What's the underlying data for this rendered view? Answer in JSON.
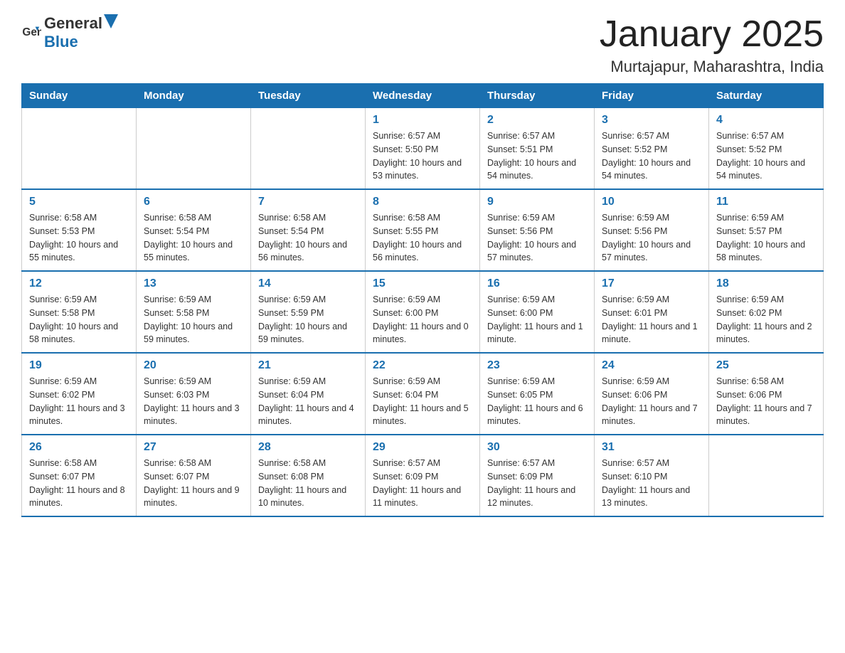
{
  "header": {
    "logo_general": "General",
    "logo_blue": "Blue",
    "title": "January 2025",
    "subtitle": "Murtajapur, Maharashtra, India"
  },
  "days_of_week": [
    "Sunday",
    "Monday",
    "Tuesday",
    "Wednesday",
    "Thursday",
    "Friday",
    "Saturday"
  ],
  "weeks": [
    [
      {
        "day": "",
        "info": ""
      },
      {
        "day": "",
        "info": ""
      },
      {
        "day": "",
        "info": ""
      },
      {
        "day": "1",
        "info": "Sunrise: 6:57 AM\nSunset: 5:50 PM\nDaylight: 10 hours and 53 minutes."
      },
      {
        "day": "2",
        "info": "Sunrise: 6:57 AM\nSunset: 5:51 PM\nDaylight: 10 hours and 54 minutes."
      },
      {
        "day": "3",
        "info": "Sunrise: 6:57 AM\nSunset: 5:52 PM\nDaylight: 10 hours and 54 minutes."
      },
      {
        "day": "4",
        "info": "Sunrise: 6:57 AM\nSunset: 5:52 PM\nDaylight: 10 hours and 54 minutes."
      }
    ],
    [
      {
        "day": "5",
        "info": "Sunrise: 6:58 AM\nSunset: 5:53 PM\nDaylight: 10 hours and 55 minutes."
      },
      {
        "day": "6",
        "info": "Sunrise: 6:58 AM\nSunset: 5:54 PM\nDaylight: 10 hours and 55 minutes."
      },
      {
        "day": "7",
        "info": "Sunrise: 6:58 AM\nSunset: 5:54 PM\nDaylight: 10 hours and 56 minutes."
      },
      {
        "day": "8",
        "info": "Sunrise: 6:58 AM\nSunset: 5:55 PM\nDaylight: 10 hours and 56 minutes."
      },
      {
        "day": "9",
        "info": "Sunrise: 6:59 AM\nSunset: 5:56 PM\nDaylight: 10 hours and 57 minutes."
      },
      {
        "day": "10",
        "info": "Sunrise: 6:59 AM\nSunset: 5:56 PM\nDaylight: 10 hours and 57 minutes."
      },
      {
        "day": "11",
        "info": "Sunrise: 6:59 AM\nSunset: 5:57 PM\nDaylight: 10 hours and 58 minutes."
      }
    ],
    [
      {
        "day": "12",
        "info": "Sunrise: 6:59 AM\nSunset: 5:58 PM\nDaylight: 10 hours and 58 minutes."
      },
      {
        "day": "13",
        "info": "Sunrise: 6:59 AM\nSunset: 5:58 PM\nDaylight: 10 hours and 59 minutes."
      },
      {
        "day": "14",
        "info": "Sunrise: 6:59 AM\nSunset: 5:59 PM\nDaylight: 10 hours and 59 minutes."
      },
      {
        "day": "15",
        "info": "Sunrise: 6:59 AM\nSunset: 6:00 PM\nDaylight: 11 hours and 0 minutes."
      },
      {
        "day": "16",
        "info": "Sunrise: 6:59 AM\nSunset: 6:00 PM\nDaylight: 11 hours and 1 minute."
      },
      {
        "day": "17",
        "info": "Sunrise: 6:59 AM\nSunset: 6:01 PM\nDaylight: 11 hours and 1 minute."
      },
      {
        "day": "18",
        "info": "Sunrise: 6:59 AM\nSunset: 6:02 PM\nDaylight: 11 hours and 2 minutes."
      }
    ],
    [
      {
        "day": "19",
        "info": "Sunrise: 6:59 AM\nSunset: 6:02 PM\nDaylight: 11 hours and 3 minutes."
      },
      {
        "day": "20",
        "info": "Sunrise: 6:59 AM\nSunset: 6:03 PM\nDaylight: 11 hours and 3 minutes."
      },
      {
        "day": "21",
        "info": "Sunrise: 6:59 AM\nSunset: 6:04 PM\nDaylight: 11 hours and 4 minutes."
      },
      {
        "day": "22",
        "info": "Sunrise: 6:59 AM\nSunset: 6:04 PM\nDaylight: 11 hours and 5 minutes."
      },
      {
        "day": "23",
        "info": "Sunrise: 6:59 AM\nSunset: 6:05 PM\nDaylight: 11 hours and 6 minutes."
      },
      {
        "day": "24",
        "info": "Sunrise: 6:59 AM\nSunset: 6:06 PM\nDaylight: 11 hours and 7 minutes."
      },
      {
        "day": "25",
        "info": "Sunrise: 6:58 AM\nSunset: 6:06 PM\nDaylight: 11 hours and 7 minutes."
      }
    ],
    [
      {
        "day": "26",
        "info": "Sunrise: 6:58 AM\nSunset: 6:07 PM\nDaylight: 11 hours and 8 minutes."
      },
      {
        "day": "27",
        "info": "Sunrise: 6:58 AM\nSunset: 6:07 PM\nDaylight: 11 hours and 9 minutes."
      },
      {
        "day": "28",
        "info": "Sunrise: 6:58 AM\nSunset: 6:08 PM\nDaylight: 11 hours and 10 minutes."
      },
      {
        "day": "29",
        "info": "Sunrise: 6:57 AM\nSunset: 6:09 PM\nDaylight: 11 hours and 11 minutes."
      },
      {
        "day": "30",
        "info": "Sunrise: 6:57 AM\nSunset: 6:09 PM\nDaylight: 11 hours and 12 minutes."
      },
      {
        "day": "31",
        "info": "Sunrise: 6:57 AM\nSunset: 6:10 PM\nDaylight: 11 hours and 13 minutes."
      },
      {
        "day": "",
        "info": ""
      }
    ]
  ]
}
